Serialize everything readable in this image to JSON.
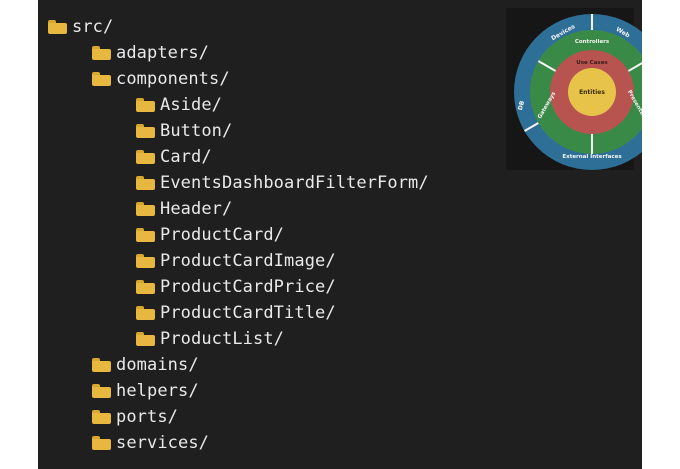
{
  "tree": [
    {
      "label": "src/",
      "depth": 0
    },
    {
      "label": "adapters/",
      "depth": 1
    },
    {
      "label": "components/",
      "depth": 1
    },
    {
      "label": "Aside/",
      "depth": 2
    },
    {
      "label": "Button/",
      "depth": 2
    },
    {
      "label": "Card/",
      "depth": 2
    },
    {
      "label": "EventsDashboardFilterForm/",
      "depth": 2
    },
    {
      "label": "Header/",
      "depth": 2
    },
    {
      "label": "ProductCard/",
      "depth": 2
    },
    {
      "label": "ProductCardImage/",
      "depth": 2
    },
    {
      "label": "ProductCardPrice/",
      "depth": 2
    },
    {
      "label": "ProductCardTitle/",
      "depth": 2
    },
    {
      "label": "ProductList/",
      "depth": 2
    },
    {
      "label": "domains/",
      "depth": 1
    },
    {
      "label": "helpers/",
      "depth": 1
    },
    {
      "label": "ports/",
      "depth": 1
    },
    {
      "label": "services/",
      "depth": 1
    }
  ],
  "diagram": {
    "outer_labels": {
      "top_left": "Devices",
      "top_right": "Web",
      "left": "DB",
      "right": "UI",
      "bottom": "External Interfaces"
    },
    "adapter_ring_labels": {
      "top": "Controllers",
      "left": "Gateways",
      "right": "Presenters"
    },
    "use_cases_label": "Use Cases",
    "entities_label": "Entities",
    "colors": {
      "outer": "#2e6f97",
      "adapters": "#3a8a47",
      "use_cases": "#b85450",
      "entities": "#e8c34a",
      "text": "#f5f5f5"
    }
  },
  "icon": "folder-icon"
}
